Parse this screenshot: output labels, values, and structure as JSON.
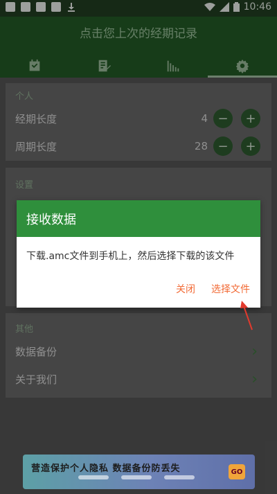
{
  "status": {
    "time": "10:46"
  },
  "appbar": {
    "title": "点击您上次的经期记录"
  },
  "tabs": [
    {
      "icon": "calendar-icon"
    },
    {
      "icon": "note-edit-icon"
    },
    {
      "icon": "bar-chart-icon"
    },
    {
      "icon": "gear-icon"
    }
  ],
  "personal": {
    "header": "个人",
    "rows": [
      {
        "label": "经期长度",
        "value": "4"
      },
      {
        "label": "周期长度",
        "value": "28"
      }
    ],
    "minus": "−",
    "plus": "+"
  },
  "settings": {
    "header": "设置"
  },
  "other": {
    "header": "其他",
    "rows": [
      {
        "label": "数据备份"
      },
      {
        "label": "关于我们"
      }
    ]
  },
  "dialog": {
    "title": "接收数据",
    "message": "下载.amc文件到手机上，然后选择下载的该文件",
    "close_label": "关闭",
    "choose_label": "选择文件"
  },
  "banner": {
    "text": "营造保护个人隐私 数据备份防丢失",
    "button": "GO"
  },
  "colors": {
    "primary": "#2f8f3c",
    "accent_text": "#f26a35"
  }
}
